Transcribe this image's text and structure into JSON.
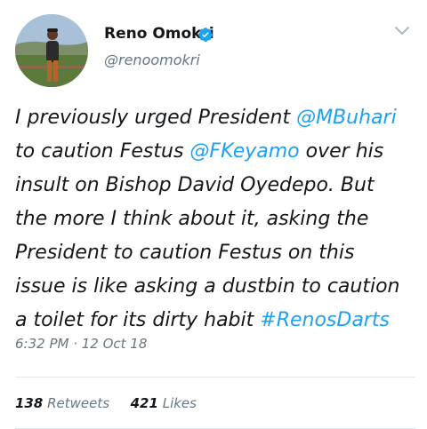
{
  "user": {
    "display_name": "Reno Omokri",
    "handle": "@renoomokri"
  },
  "tweet": {
    "lines": [
      [
        {
          "t": "I previously urged President "
        },
        {
          "t": "@MBuhari",
          "link": true
        }
      ],
      [
        {
          "t": "to caution Festus "
        },
        {
          "t": "@FKeyamo",
          "link": true
        },
        {
          "t": " over his"
        }
      ],
      [
        {
          "t": "insult on Bishop David Oyedepo. But"
        }
      ],
      [
        {
          "t": "the more I think about it, asking the"
        }
      ],
      [
        {
          "t": "President to caution Festus on this"
        }
      ],
      [
        {
          "t": "issue is like asking a dustbin to caution"
        }
      ],
      [
        {
          "t": "a toilet for its dirty habit "
        },
        {
          "t": "#RenosDarts",
          "link": true
        }
      ]
    ],
    "timestamp": "6:32 PM · 12 Oct 18"
  },
  "stats": {
    "retweets_count": "138",
    "retweets_label": "Retweets",
    "likes_count": "421",
    "likes_label": "Likes"
  },
  "colors": {
    "link": "#1da1f2",
    "secondary_text": "#657786",
    "primary_text": "#14171a",
    "divider": "#e1e8ed"
  },
  "icons": [
    "verified-badge-icon",
    "chevron-down-icon"
  ]
}
